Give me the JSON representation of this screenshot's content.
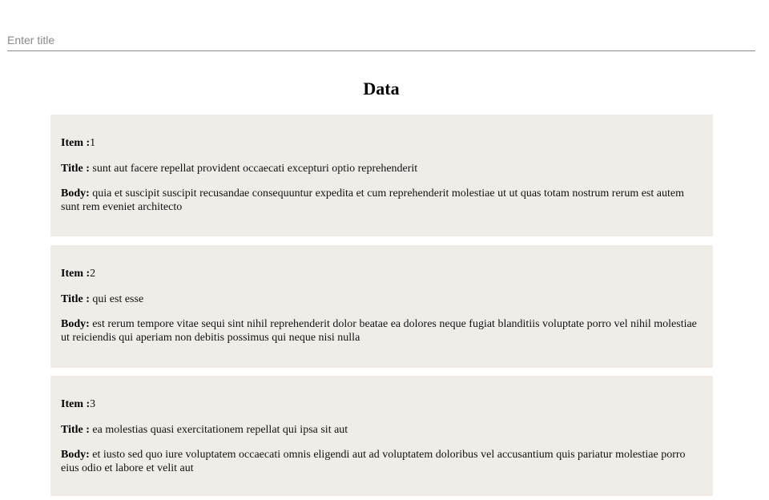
{
  "search": {
    "placeholder": "Enter title",
    "value": ""
  },
  "heading": "Data",
  "labels": {
    "item": "Item :",
    "title": "Title : ",
    "body": "Body: "
  },
  "posts": [
    {
      "item": "1",
      "title": "sunt aut facere repellat provident occaecati excepturi optio reprehenderit",
      "body": "quia et suscipit suscipit recusandae consequuntur expedita et cum reprehenderit molestiae ut ut quas totam nostrum rerum est autem sunt rem eveniet architecto"
    },
    {
      "item": "2",
      "title": "qui est esse",
      "body": "est rerum tempore vitae sequi sint nihil reprehenderit dolor beatae ea dolores neque fugiat blanditiis voluptate porro vel nihil molestiae ut reiciendis qui aperiam non debitis possimus qui neque nisi nulla"
    },
    {
      "item": "3",
      "title": "ea molestias quasi exercitationem repellat qui ipsa sit aut",
      "body": "et iusto sed quo iure voluptatem occaecati omnis eligendi aut ad voluptatem doloribus vel accusantium quis pariatur molestiae porro eius odio et labore et velit aut"
    }
  ],
  "colors": {
    "card_background": "#f0ede9",
    "input_underline": "#8a8a8a",
    "placeholder": "#8a8a8a"
  }
}
